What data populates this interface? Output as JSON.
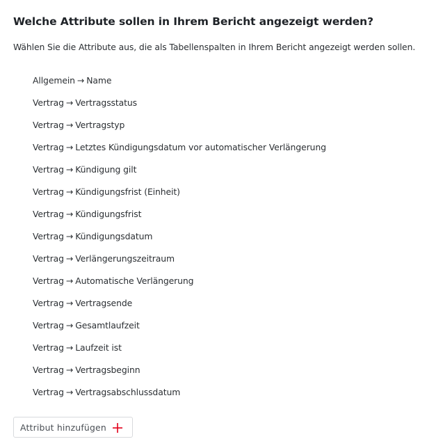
{
  "header": {
    "title": "Welche Attribute sollen in Ihrem Bericht angezeigt werden?",
    "subtitle": "Wählen Sie die Attribute aus, die als Tabellenspalten in Ihrem Bericht angezeigt werden sollen."
  },
  "attributes": [
    {
      "group": "Allgemein",
      "arrow": "→",
      "name": "Name"
    },
    {
      "group": "Vertrag",
      "arrow": "→",
      "name": "Vertragsstatus"
    },
    {
      "group": "Vertrag",
      "arrow": "→",
      "name": "Vertragstyp"
    },
    {
      "group": "Vertrag",
      "arrow": "→",
      "name": "Letztes Kündigungsdatum vor automatischer Verlängerung"
    },
    {
      "group": "Vertrag",
      "arrow": "→",
      "name": "Kündigung gilt"
    },
    {
      "group": "Vertrag",
      "arrow": "→",
      "name": "Kündigungsfrist (Einheit)"
    },
    {
      "group": "Vertrag",
      "arrow": "→",
      "name": "Kündigungsfrist"
    },
    {
      "group": "Vertrag",
      "arrow": "→",
      "name": "Kündigungsdatum"
    },
    {
      "group": "Vertrag",
      "arrow": "→",
      "name": "Verlängerungszeitraum"
    },
    {
      "group": "Vertrag",
      "arrow": "→",
      "name": "Automatische Verlängerung"
    },
    {
      "group": "Vertrag",
      "arrow": "→",
      "name": "Vertragsende"
    },
    {
      "group": "Vertrag",
      "arrow": "→",
      "name": "Gesamtlaufzeit"
    },
    {
      "group": "Vertrag",
      "arrow": "→",
      "name": "Laufzeit ist"
    },
    {
      "group": "Vertrag",
      "arrow": "→",
      "name": "Vertragsbeginn"
    },
    {
      "group": "Vertrag",
      "arrow": "→",
      "name": "Vertragsabschlussdatum"
    }
  ],
  "add_button": {
    "label": "Attribut hinzufügen",
    "icon": "plus-icon",
    "icon_color": "#e2001a"
  }
}
